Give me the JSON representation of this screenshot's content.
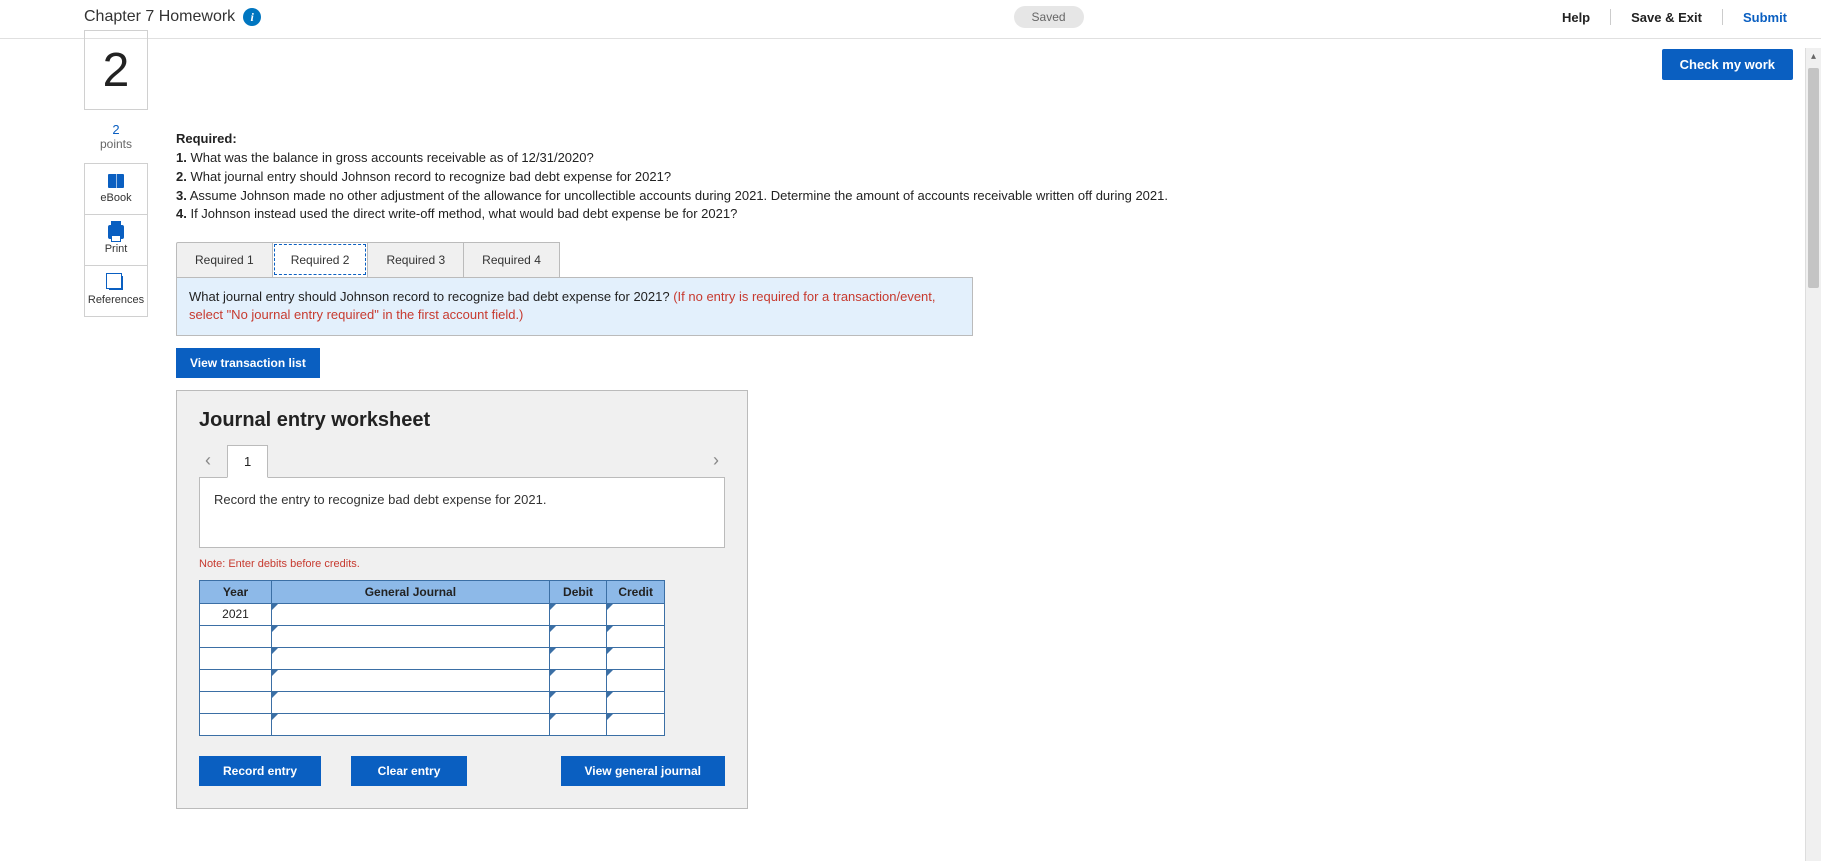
{
  "header": {
    "title": "Chapter 7 Homework",
    "saved": "Saved",
    "links": {
      "help": "Help",
      "save_exit": "Save & Exit",
      "submit": "Submit"
    }
  },
  "actionbar": {
    "check": "Check my work"
  },
  "left": {
    "number": "2",
    "sub_number": "2",
    "points_label": "points",
    "side": {
      "ebook": "eBook",
      "print": "Print",
      "references": "References"
    }
  },
  "required": {
    "heading": "Required:",
    "items": [
      "What was the balance in gross accounts receivable as of 12/31/2020?",
      "What journal entry should Johnson record to recognize bad debt expense for 2021?",
      "Assume Johnson made no other adjustment of the allowance for uncollectible accounts during 2021. Determine the amount of accounts receivable written off during 2021.",
      "If Johnson instead used the direct write-off method, what would bad debt expense be for 2021?"
    ]
  },
  "tabs": [
    "Required 1",
    "Required 2",
    "Required 3",
    "Required 4"
  ],
  "active_tab": 1,
  "instruction": {
    "black": "What journal entry should Johnson record to recognize bad debt expense for 2021? ",
    "red": "(If no entry is required for a transaction/event, select \"No journal entry required\" in the first account field.)"
  },
  "vtl": "View transaction list",
  "worksheet": {
    "title": "Journal entry worksheet",
    "pager": {
      "left": "‹",
      "right": "›",
      "current": "1"
    },
    "entry_desc": "Record the entry to recognize bad debt expense for 2021.",
    "note": "Note: Enter debits before credits.",
    "table": {
      "headers": {
        "year": "Year",
        "gj": "General Journal",
        "debit": "Debit",
        "credit": "Credit"
      },
      "rows": [
        {
          "year": "2021",
          "gj": "",
          "debit": "",
          "credit": ""
        },
        {
          "year": "",
          "gj": "",
          "debit": "",
          "credit": ""
        },
        {
          "year": "",
          "gj": "",
          "debit": "",
          "credit": ""
        },
        {
          "year": "",
          "gj": "",
          "debit": "",
          "credit": ""
        },
        {
          "year": "",
          "gj": "",
          "debit": "",
          "credit": ""
        },
        {
          "year": "",
          "gj": "",
          "debit": "",
          "credit": ""
        }
      ]
    },
    "buttons": {
      "record": "Record entry",
      "clear": "Clear entry",
      "view": "View general journal"
    }
  }
}
